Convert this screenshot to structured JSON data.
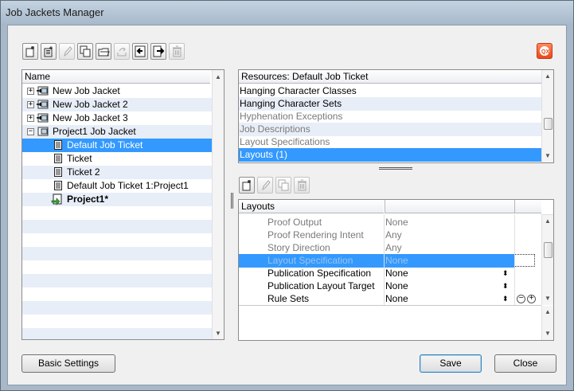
{
  "window": {
    "title": "Job Jackets Manager"
  },
  "toolbar": {
    "buttons": [
      "new-job-jacket",
      "new-job-ticket",
      "edit",
      "duplicate",
      "open",
      "link",
      "import",
      "export",
      "delete"
    ]
  },
  "tree": {
    "header": "Name",
    "items": [
      {
        "label": "New Job Jacket",
        "level": 0,
        "expander": "+"
      },
      {
        "label": "New Job Jacket 2",
        "level": 0,
        "expander": "+"
      },
      {
        "label": "New Job Jacket 3",
        "level": 0,
        "expander": "+"
      },
      {
        "label": "Project1 Job Jacket",
        "level": 0,
        "expander": "−"
      },
      {
        "label": "Default Job Ticket",
        "level": 1,
        "selected": true
      },
      {
        "label": "Ticket",
        "level": 1
      },
      {
        "label": "Ticket 2",
        "level": 1
      },
      {
        "label": "Default Job Ticket 1:Project1",
        "level": 1
      },
      {
        "label": "Project1*",
        "level": 1,
        "bold": true
      }
    ]
  },
  "resources": {
    "header": "Resources: Default Job Ticket",
    "items": [
      {
        "label": "Hanging Character Classes",
        "state": "normal"
      },
      {
        "label": "Hanging Character Sets",
        "state": "normal"
      },
      {
        "label": "Hyphenation Exceptions",
        "state": "disabled"
      },
      {
        "label": "Job Descriptions",
        "state": "disabled"
      },
      {
        "label": "Layout Specifications",
        "state": "disabled"
      },
      {
        "label": "Layouts (1)",
        "state": "selected"
      }
    ]
  },
  "layouts": {
    "header": "Layouts",
    "rows": [
      {
        "name": "Proof Output",
        "value": "None",
        "state": "disabled",
        "spinner": false
      },
      {
        "name": "Proof Rendering Intent",
        "value": "Any",
        "state": "disabled",
        "spinner": false
      },
      {
        "name": "Story Direction",
        "value": "Any",
        "state": "disabled",
        "spinner": false
      },
      {
        "name": "Layout Specification",
        "value": "None",
        "state": "selected",
        "spinner": false
      },
      {
        "name": "Publication Specification",
        "value": "None",
        "state": "normal",
        "spinner": true
      },
      {
        "name": "Publication Layout Target",
        "value": "None",
        "state": "normal",
        "spinner": true
      },
      {
        "name": "Rule Sets",
        "value": "None",
        "state": "normal",
        "spinner": true
      }
    ]
  },
  "buttons": {
    "basic_settings": "Basic Settings",
    "save": "Save",
    "close": "Close"
  },
  "colors": {
    "selection": "#3399ff",
    "alt_row": "#e8eef8",
    "disabled_text": "#7a7a7a"
  }
}
